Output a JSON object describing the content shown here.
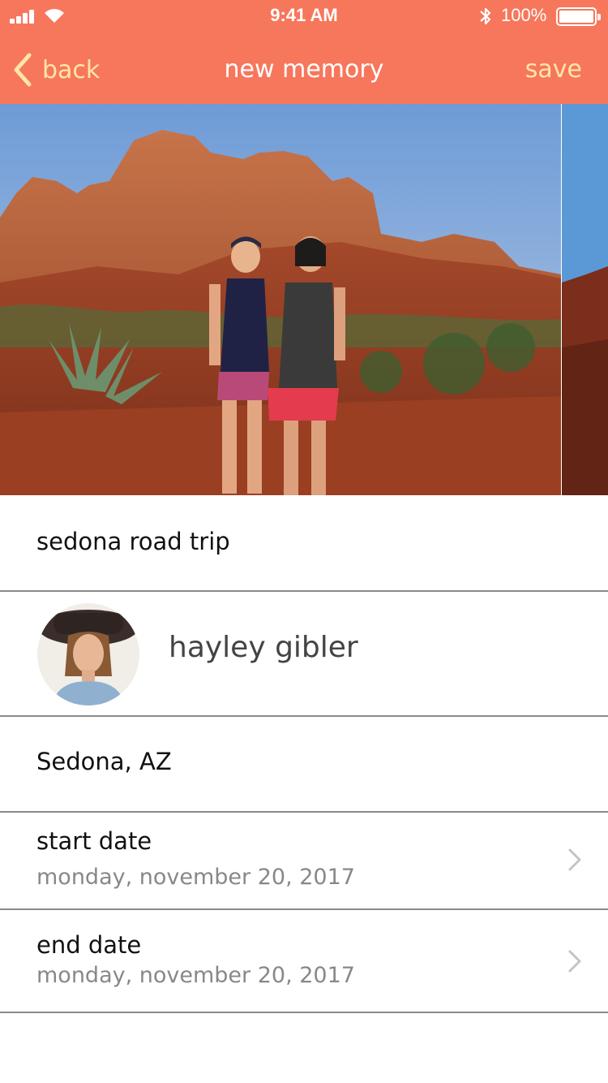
{
  "status_bar": {
    "time": "9:41 AM",
    "battery": "100%"
  },
  "nav": {
    "back_label": "back",
    "title": "new memory",
    "save_label": "save"
  },
  "colors": {
    "header": "#F7775C",
    "nav_action": "#FFE6A6",
    "divider": "#8a8a8a",
    "subtext": "#888888"
  },
  "form": {
    "title_value": "sedona road trip",
    "person_name": "hayley gibler",
    "location_value": "Sedona, AZ",
    "start_date": {
      "label": "start date",
      "value": "monday, november 20, 2017"
    },
    "end_date": {
      "label": "end date",
      "value": "monday, november 20, 2017"
    }
  },
  "icons": {
    "back": "chevron-left-icon",
    "disclosure": "chevron-right-icon",
    "bluetooth": "bluetooth-icon",
    "wifi": "wifi-icon"
  }
}
